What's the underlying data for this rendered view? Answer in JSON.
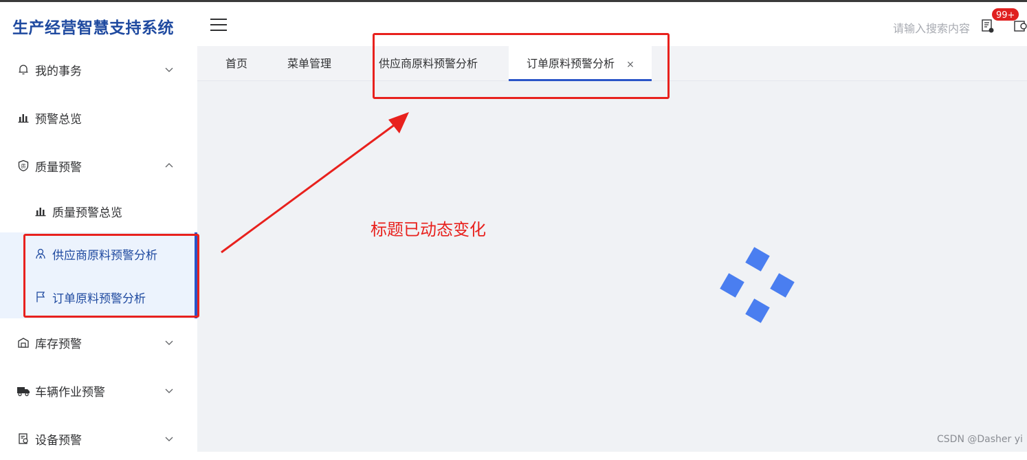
{
  "app": {
    "title": "生产经营智慧支持系统"
  },
  "sidebar": {
    "items": [
      {
        "label": "我的事务",
        "icon": "bell-icon"
      },
      {
        "label": "预警总览",
        "icon": "bar-chart-icon"
      },
      {
        "label": "质量预警",
        "icon": "quality-shield-icon",
        "expanded": true
      },
      {
        "label": "库存预警",
        "icon": "warehouse-icon"
      },
      {
        "label": "车辆作业预警",
        "icon": "truck-icon"
      },
      {
        "label": "设备预警",
        "icon": "device-icon"
      }
    ],
    "sub_items": [
      {
        "label": "质量预警总览",
        "icon": "bar-chart-icon"
      },
      {
        "label": "供应商原料预警分析",
        "icon": "supplier-icon"
      },
      {
        "label": "订单原料预警分析",
        "icon": "flag-icon"
      }
    ]
  },
  "header": {
    "search_placeholder": "请输入搜索内容",
    "notification_badge": "99+"
  },
  "tabs": [
    {
      "label": "首页"
    },
    {
      "label": "菜单管理"
    },
    {
      "label": "供应商原料预警分析"
    },
    {
      "label": "订单原料预警分析",
      "active": true,
      "close": "×"
    }
  ],
  "annotation": {
    "text": "标题已动态变化",
    "color": "#e8211d"
  },
  "watermark": "CSDN @Dasher yi",
  "colors": {
    "brand": "#1f4aa0",
    "accent": "#2a54c8",
    "loader": "#4a7ef0",
    "annotation_red": "#e8211d"
  }
}
